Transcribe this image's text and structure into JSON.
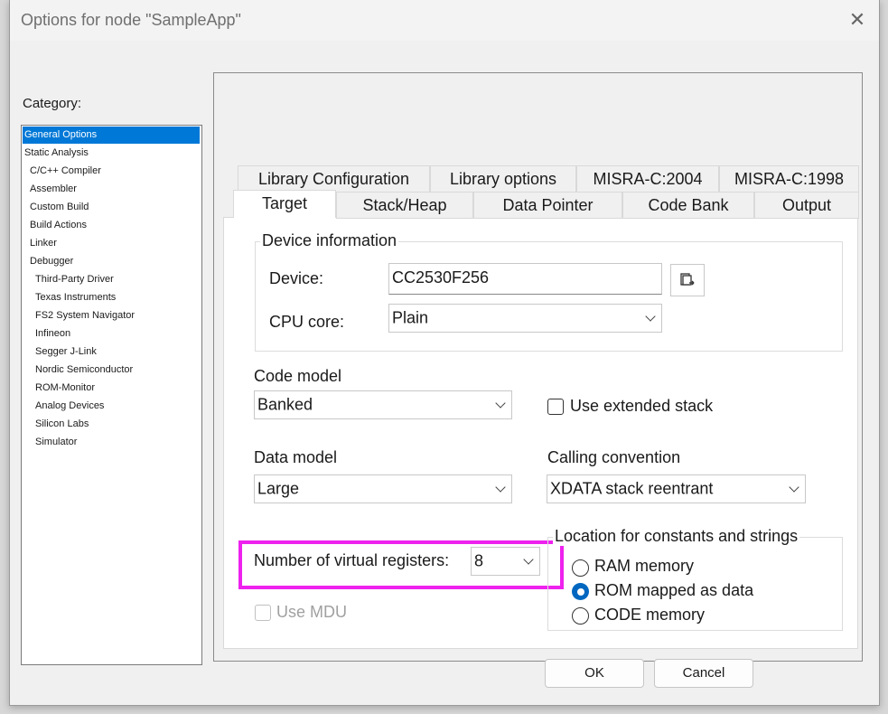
{
  "window": {
    "title": "Options for node \"SampleApp\"",
    "close_label": "✕"
  },
  "category": {
    "label": "Category:",
    "items": [
      {
        "label": "General Options",
        "selected": true
      },
      {
        "label": "Static Analysis"
      },
      {
        "label": "C/C++ Compiler"
      },
      {
        "label": "Assembler"
      },
      {
        "label": "Custom Build"
      },
      {
        "label": "Build Actions"
      },
      {
        "label": "Linker"
      },
      {
        "label": "Debugger"
      },
      {
        "label": "Third-Party Driver"
      },
      {
        "label": "Texas Instruments"
      },
      {
        "label": "FS2 System Navigator"
      },
      {
        "label": "Infineon"
      },
      {
        "label": "Segger J-Link"
      },
      {
        "label": "Nordic Semiconductor"
      },
      {
        "label": "ROM-Monitor"
      },
      {
        "label": "Analog Devices"
      },
      {
        "label": "Silicon Labs"
      },
      {
        "label": "Simulator"
      }
    ]
  },
  "tabs": {
    "row1": [
      "Library Configuration",
      "Library options",
      "MISRA-C:2004",
      "MISRA-C:1998"
    ],
    "row2": [
      "Target",
      "Stack/Heap",
      "Data Pointer",
      "Code Bank",
      "Output"
    ],
    "active": "Target"
  },
  "device_info": {
    "group_title": "Device information",
    "device_label": "Device:",
    "device_value": "CC2530F256",
    "browse_icon": "browse-device-icon",
    "cpu_label": "CPU core:",
    "cpu_value": "Plain"
  },
  "code_model": {
    "label": "Code model",
    "value": "Banked"
  },
  "extended_stack": {
    "label": "Use extended stack",
    "checked": false
  },
  "data_model": {
    "label": "Data model",
    "value": "Large"
  },
  "calling_convention": {
    "label": "Calling convention",
    "value": "XDATA stack reentrant"
  },
  "virtual_registers": {
    "label": "Number of virtual registers:",
    "value": "8"
  },
  "use_mdu": {
    "label": "Use MDU",
    "checked": false,
    "disabled": true
  },
  "constants_location": {
    "group_title": "Location for constants and strings",
    "options": [
      {
        "label": "RAM memory",
        "selected": false
      },
      {
        "label": "ROM mapped as data",
        "selected": true
      },
      {
        "label": "CODE memory",
        "selected": false
      }
    ]
  },
  "buttons": {
    "ok": "OK",
    "cancel": "Cancel"
  },
  "colors": {
    "selection": "#0078d7",
    "radio_selected": "#0067c0",
    "highlight": "#ee22ee"
  }
}
